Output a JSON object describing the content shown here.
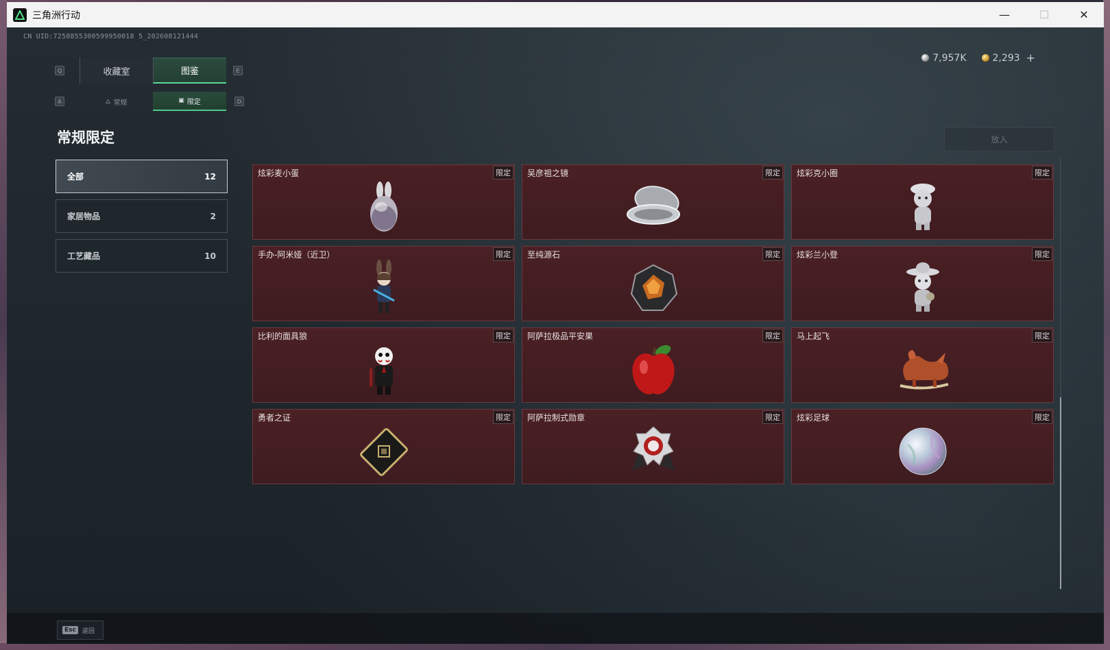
{
  "window": {
    "title": "三角洲行动",
    "minimize": "—",
    "maximize": "☐",
    "close": "✕"
  },
  "header": {
    "uid": "CN UID:7258855300599950018 5_202608121444",
    "currency": {
      "silver": "7,957K",
      "gold": "2,293",
      "plus": "+"
    }
  },
  "keys": {
    "q": "Q",
    "e": "E",
    "a": "A",
    "d": "D"
  },
  "main_tabs": [
    {
      "label": "收藏室"
    },
    {
      "label": "图鉴"
    }
  ],
  "sub_tabs": [
    {
      "label": "常规",
      "icon": "flame-icon"
    },
    {
      "label": "限定",
      "icon": "image-icon"
    }
  ],
  "section": {
    "title": "常规限定",
    "put_in": "放入"
  },
  "categories": [
    {
      "label": "全部",
      "count": "12"
    },
    {
      "label": "家居物品",
      "count": "2"
    },
    {
      "label": "工艺藏品",
      "count": "10"
    }
  ],
  "badge": "限定",
  "items": [
    {
      "name": "炫彩麦小蛋",
      "icon": "egg-bunny-icon"
    },
    {
      "name": "吴彦祖之镜",
      "icon": "compact-mirror-icon"
    },
    {
      "name": "炫彩克小圈",
      "icon": "figure-hat-icon"
    },
    {
      "name": "手办-阿米娅（近卫）",
      "icon": "bunny-figure-icon"
    },
    {
      "name": "至纯源石",
      "icon": "crystal-icon"
    },
    {
      "name": "炫彩兰小登",
      "icon": "sombrero-figure-icon"
    },
    {
      "name": "比利的面具狼",
      "icon": "puppet-icon"
    },
    {
      "name": "阿萨拉极品平安果",
      "icon": "apple-icon"
    },
    {
      "name": "马上起飞",
      "icon": "horse-icon"
    },
    {
      "name": "勇者之证",
      "icon": "card-icon"
    },
    {
      "name": "阿萨拉制式勋章",
      "icon": "medal-icon"
    },
    {
      "name": "炫彩足球",
      "icon": "ball-icon"
    }
  ],
  "footer": {
    "esc_key": "Esc",
    "esc_label": "返回"
  }
}
